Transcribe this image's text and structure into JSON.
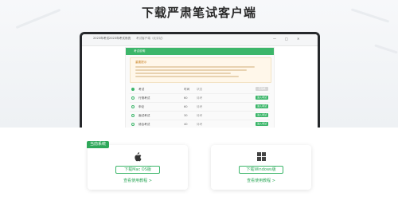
{
  "page": {
    "title": "下载严肃笔试客户端"
  },
  "app_window": {
    "title": "2023年考试2023年考试系统",
    "tab": "考试客户端（北京站）",
    "controls": [
      "—",
      "□",
      "✕"
    ],
    "panel_header": "考试说明",
    "notice_title": "重要提示"
  },
  "exam_rows": [
    {
      "name": "考试",
      "col2": "时间",
      "col3": "状态",
      "col4": "",
      "button": "已完成",
      "active": true,
      "enabled": false
    },
    {
      "name": "行测考试",
      "col2": "60",
      "col3": "待考",
      "col4": "",
      "button": "进入考试",
      "active": false,
      "enabled": true
    },
    {
      "name": "申论",
      "col2": "60",
      "col3": "待考",
      "col4": "",
      "button": "进入考试",
      "active": false,
      "enabled": true
    },
    {
      "name": "面试考试",
      "col2": "30",
      "col3": "待考",
      "col4": "",
      "button": "进入考试",
      "active": false,
      "enabled": true
    },
    {
      "name": "综合考试",
      "col2": "40",
      "col3": "待考",
      "col4": "",
      "button": "进入考试",
      "active": false,
      "enabled": true
    }
  ],
  "downloads": {
    "mac": {
      "badge": "当前系统",
      "icon": "apple-icon",
      "button": "下载Mac OS版",
      "link": "查看使用教程 >"
    },
    "win": {
      "icon": "windows-icon",
      "button": "下载Windows版",
      "link": "查看使用教程 >"
    }
  },
  "colors": {
    "accent": "#3cb66a",
    "notice_bg": "#fff7ea"
  }
}
